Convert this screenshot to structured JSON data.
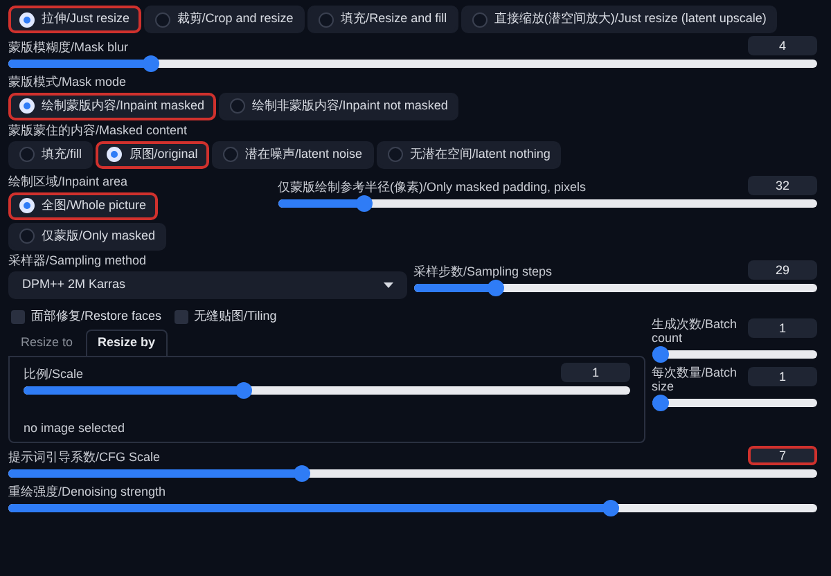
{
  "resize_mode": {
    "options": [
      {
        "label": "拉伸/Just resize",
        "selected": true,
        "highlighted": true
      },
      {
        "label": "裁剪/Crop and resize",
        "selected": false,
        "highlighted": false
      },
      {
        "label": "填充/Resize and fill",
        "selected": false,
        "highlighted": false
      },
      {
        "label": "直接缩放(潜空间放大)/Just resize (latent upscale)",
        "selected": false,
        "highlighted": false
      }
    ]
  },
  "mask_blur": {
    "label": "蒙版模糊度/Mask blur",
    "value": "4",
    "level": 0.17
  },
  "mask_mode": {
    "label": "蒙版模式/Mask mode",
    "options": [
      {
        "label": "绘制蒙版内容/Inpaint masked",
        "selected": true,
        "highlighted": true
      },
      {
        "label": "绘制非蒙版内容/Inpaint not masked",
        "selected": false,
        "highlighted": false
      }
    ]
  },
  "masked_content": {
    "label": "蒙版蒙住的内容/Masked content",
    "options": [
      {
        "label": "填充/fill",
        "selected": false,
        "highlighted": false
      },
      {
        "label": "原图/original",
        "selected": true,
        "highlighted": true
      },
      {
        "label": "潜在噪声/latent noise",
        "selected": false,
        "highlighted": false
      },
      {
        "label": "无潜在空间/latent nothing",
        "selected": false,
        "highlighted": false
      }
    ]
  },
  "inpaint_area": {
    "label": "绘制区域/Inpaint area",
    "options": [
      {
        "label": "全图/Whole picture",
        "selected": true,
        "highlighted": true
      },
      {
        "label": "仅蒙版/Only masked",
        "selected": false,
        "highlighted": false
      }
    ]
  },
  "padding": {
    "label": "仅蒙版绘制参考半径(像素)/Only masked padding, pixels",
    "value": "32",
    "level": 0.15
  },
  "sampling_method": {
    "label": "采样器/Sampling method",
    "value": "DPM++ 2M Karras"
  },
  "sampling_steps": {
    "label": "采样步数/Sampling steps",
    "value": "29",
    "level": 0.19
  },
  "checkboxes": [
    {
      "label": "面部修复/Restore faces",
      "checked": false
    },
    {
      "label": "无缝贴图/Tiling",
      "checked": false
    }
  ],
  "resize_tabs": [
    {
      "label": "Resize to",
      "selected": false
    },
    {
      "label": "Resize by",
      "selected": true
    }
  ],
  "scale": {
    "label": "比例/Scale",
    "value": "1",
    "level": 0.36,
    "note": "no image selected"
  },
  "batch_count": {
    "label": "生成次数/Batch count",
    "value": "1",
    "level": 0
  },
  "batch_size": {
    "label": "每次数量/Batch size",
    "value": "1",
    "level": 0
  },
  "cfg_scale": {
    "label": "提示词引导系数/CFG Scale",
    "value": "7",
    "level": 0.36,
    "highlighted": true
  },
  "denoising_strength": {
    "label": "重绘强度/Denoising strength",
    "level": 0.75
  }
}
